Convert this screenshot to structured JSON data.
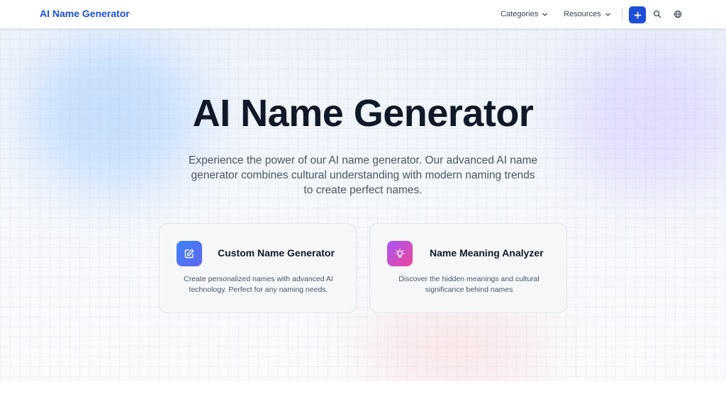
{
  "header": {
    "logo": "AI Name Generator",
    "nav": [
      {
        "label": "Categories"
      },
      {
        "label": "Resources"
      }
    ],
    "icons": [
      "plus-icon",
      "search-icon",
      "globe-icon"
    ]
  },
  "hero": {
    "title": "AI Name Generator",
    "subtitle": "Experience the power of our AI name generator. Our advanced AI name generator combines cultural understanding with modern naming trends to create perfect names."
  },
  "cards": [
    {
      "icon": "edit-icon",
      "title": "Custom Name Generator",
      "description": "Create personalized names with advanced AI technology. Perfect for any naming needs."
    },
    {
      "icon": "lightbulb-icon",
      "title": "Name Meaning Analyzer",
      "description": "Discover the hidden meanings and cultural significance behind names"
    }
  ],
  "colors": {
    "brand": "#1d4ed8",
    "card_bg": "#f5f7f9"
  }
}
